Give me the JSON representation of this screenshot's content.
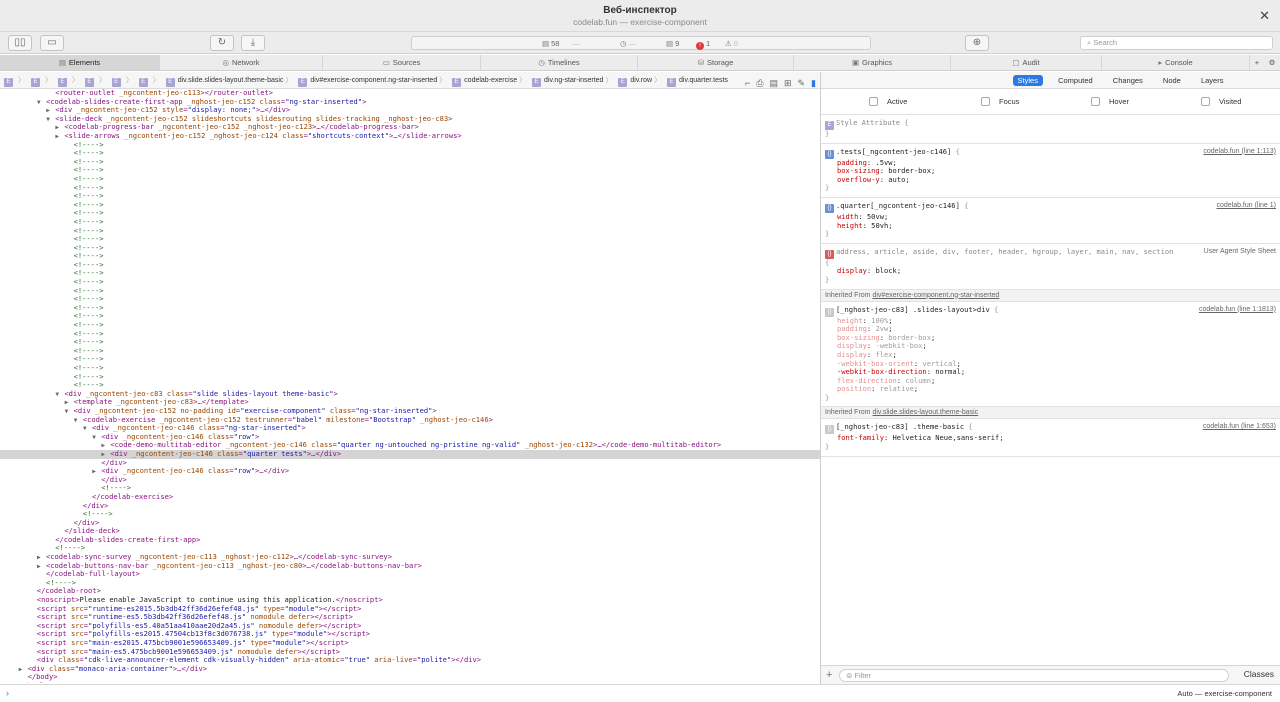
{
  "window": {
    "title": "Веб-инспектор",
    "subtitle": "codelab.fun — exercise-component",
    "close": "✕"
  },
  "toolbar": {
    "activity": {
      "resources": "58",
      "resources_size": "—",
      "time": "—",
      "logs": "9",
      "errors": "1",
      "warnings": "0"
    },
    "search_placeholder": "Search"
  },
  "tabs": [
    {
      "label": "Elements",
      "icon": "▤"
    },
    {
      "label": "Network",
      "icon": "◎"
    },
    {
      "label": "Sources",
      "icon": "▭"
    },
    {
      "label": "Timelines",
      "icon": "◷"
    },
    {
      "label": "Storage",
      "icon": "⛁"
    },
    {
      "label": "Graphics",
      "icon": "▣"
    },
    {
      "label": "Audit",
      "icon": "▢"
    },
    {
      "label": "Console",
      "icon": "▸"
    }
  ],
  "breadcrumb": {
    "e": "E",
    "items": [
      "div.slide.slides-layout.theme-basic",
      "div#exercise-component.ng-star-inserted",
      "codelab-exercise",
      "div.ng-star-inserted",
      "div.row",
      "div.quarter.tests"
    ]
  },
  "dom_lines": [
    {
      "i": 6,
      "t": "",
      "h": "<span class=\"tg\">&lt;router-outlet</span> <span class=\"an\">_ngcontent-jeo-c113</span><span class=\"tg\">&gt;&lt;/router-outlet&gt;</span>"
    },
    {
      "i": 5,
      "t": "▼",
      "h": "<span class=\"tg\">&lt;codelab-slides-create-first-app</span> <span class=\"an\">_nghost-jeo-c152 class</span>=<span class=\"av\">\"ng-star-inserted\"</span><span class=\"tg\">&gt;</span>"
    },
    {
      "i": 6,
      "t": "▶",
      "h": "<span class=\"tg\">&lt;div</span> <span class=\"an\">_ngcontent-jeo-c152 style</span>=<span class=\"av\">\"display: none;\"</span><span class=\"tg\">&gt;</span>…<span class=\"tg\">&lt;/div&gt;</span>"
    },
    {
      "i": 6,
      "t": "▼",
      "h": "<span class=\"tg\">&lt;slide-deck</span> <span class=\"an\">_ngcontent-jeo-c152 slideshortcuts slidesrouting slides-tracking _nghost-jeo-c83</span><span class=\"tg\">&gt;</span>"
    },
    {
      "i": 7,
      "t": "▶",
      "h": "<span class=\"tg\">&lt;codelab-progress-bar</span> <span class=\"an\">_ngcontent-jeo-c152 _nghost-jeo-c123</span><span class=\"tg\">&gt;</span>…<span class=\"tg\">&lt;/codelab-progress-bar&gt;</span>"
    },
    {
      "i": 7,
      "t": "▶",
      "h": "<span class=\"tg\">&lt;slide-arrows</span> <span class=\"an\">_ngcontent-jeo-c152 _nghost-jeo-c124 class</span>=<span class=\"av\">\"shortcuts-context\"</span><span class=\"tg\">&gt;</span>…<span class=\"tg\">&lt;/slide-arrows&gt;</span>"
    },
    {
      "i": 8,
      "t": "",
      "h": "<span class=\"cm\">&lt;!----&gt;</span>"
    },
    {
      "i": 8,
      "t": "",
      "h": "<span class=\"cm\">&lt;!----&gt;</span>"
    },
    {
      "i": 8,
      "t": "",
      "h": "<span class=\"cm\">&lt;!----&gt;</span>"
    },
    {
      "i": 8,
      "t": "",
      "h": "<span class=\"cm\">&lt;!----&gt;</span>"
    },
    {
      "i": 8,
      "t": "",
      "h": "<span class=\"cm\">&lt;!----&gt;</span>"
    },
    {
      "i": 8,
      "t": "",
      "h": "<span class=\"cm\">&lt;!----&gt;</span>"
    },
    {
      "i": 8,
      "t": "",
      "h": "<span class=\"cm\">&lt;!----&gt;</span>"
    },
    {
      "i": 8,
      "t": "",
      "h": "<span class=\"cm\">&lt;!----&gt;</span>"
    },
    {
      "i": 8,
      "t": "",
      "h": "<span class=\"cm\">&lt;!----&gt;</span>"
    },
    {
      "i": 8,
      "t": "",
      "h": "<span class=\"cm\">&lt;!----&gt;</span>"
    },
    {
      "i": 8,
      "t": "",
      "h": "<span class=\"cm\">&lt;!----&gt;</span>"
    },
    {
      "i": 8,
      "t": "",
      "h": "<span class=\"cm\">&lt;!----&gt;</span>"
    },
    {
      "i": 8,
      "t": "",
      "h": "<span class=\"cm\">&lt;!----&gt;</span>"
    },
    {
      "i": 8,
      "t": "",
      "h": "<span class=\"cm\">&lt;!----&gt;</span>"
    },
    {
      "i": 8,
      "t": "",
      "h": "<span class=\"cm\">&lt;!----&gt;</span>"
    },
    {
      "i": 8,
      "t": "",
      "h": "<span class=\"cm\">&lt;!----&gt;</span>"
    },
    {
      "i": 8,
      "t": "",
      "h": "<span class=\"cm\">&lt;!----&gt;</span>"
    },
    {
      "i": 8,
      "t": "",
      "h": "<span class=\"cm\">&lt;!----&gt;</span>"
    },
    {
      "i": 8,
      "t": "",
      "h": "<span class=\"cm\">&lt;!----&gt;</span>"
    },
    {
      "i": 8,
      "t": "",
      "h": "<span class=\"cm\">&lt;!----&gt;</span>"
    },
    {
      "i": 8,
      "t": "",
      "h": "<span class=\"cm\">&lt;!----&gt;</span>"
    },
    {
      "i": 8,
      "t": "",
      "h": "<span class=\"cm\">&lt;!----&gt;</span>"
    },
    {
      "i": 8,
      "t": "",
      "h": "<span class=\"cm\">&lt;!----&gt;</span>"
    },
    {
      "i": 8,
      "t": "",
      "h": "<span class=\"cm\">&lt;!----&gt;</span>"
    },
    {
      "i": 8,
      "t": "",
      "h": "<span class=\"cm\">&lt;!----&gt;</span>"
    },
    {
      "i": 8,
      "t": "",
      "h": "<span class=\"cm\">&lt;!----&gt;</span>"
    },
    {
      "i": 8,
      "t": "",
      "h": "<span class=\"cm\">&lt;!----&gt;</span>"
    },
    {
      "i": 8,
      "t": "",
      "h": "<span class=\"cm\">&lt;!----&gt;</span>"
    },
    {
      "i": 8,
      "t": "",
      "h": "<span class=\"cm\">&lt;!----&gt;</span>"
    },
    {
      "i": 7,
      "t": "▼",
      "h": "<span class=\"tg\">&lt;div</span> <span class=\"an\">_ngcontent-jeo-c83 class</span>=<span class=\"av\">\"slide slides-layout theme-basic\"</span><span class=\"tg\">&gt;</span>"
    },
    {
      "i": 8,
      "t": "▶",
      "h": "<span class=\"tg\">&lt;template</span> <span class=\"an\">_ngcontent-jeo-c83</span><span class=\"tg\">&gt;</span>…<span class=\"tg\">&lt;/template&gt;</span>"
    },
    {
      "i": 8,
      "t": "▼",
      "h": "<span class=\"tg\">&lt;div</span> <span class=\"an\">_ngcontent-jeo-c152 no-padding id</span>=<span class=\"av\">\"exercise-component\"</span> <span class=\"an\">class</span>=<span class=\"av\">\"ng-star-inserted\"</span><span class=\"tg\">&gt;</span>"
    },
    {
      "i": 9,
      "t": "▼",
      "h": "<span class=\"tg\">&lt;codelab-exercise</span> <span class=\"an\">_ngcontent-jeo-c152 testrunner</span>=<span class=\"av\">\"babel\"</span> <span class=\"an\">milestone</span>=<span class=\"av\">\"Bootstrap\"</span> <span class=\"an\">_nghost-jeo-c146</span><span class=\"tg\">&gt;</span>"
    },
    {
      "i": 10,
      "t": "▼",
      "h": "<span class=\"tg\">&lt;div</span> <span class=\"an\">_ngcontent-jeo-c146 class</span>=<span class=\"av\">\"ng-star-inserted\"</span><span class=\"tg\">&gt;</span>"
    },
    {
      "i": 11,
      "t": "▼",
      "h": "<span class=\"tg\">&lt;div</span> <span class=\"an\">_ngcontent-jeo-c146 class</span>=<span class=\"av\">\"row\"</span><span class=\"tg\">&gt;</span>"
    },
    {
      "i": 12,
      "t": "▶",
      "h": "<span class=\"tg\">&lt;code-demo-multitab-editor</span> <span class=\"an\">_ngcontent-jeo-c146 class</span>=<span class=\"av\">\"quarter ng-untouched ng-pristine ng-valid\"</span> <span class=\"an\">_nghost-jeo-c132</span><span class=\"tg\">&gt;</span>…<span class=\"tg\">&lt;/code-demo-multitab-editor&gt;</span>"
    },
    {
      "i": 12,
      "t": "▶",
      "sel": true,
      "h": "<span class=\"tg\">&lt;div</span> <span class=\"an\">_ngcontent-jeo-c146 class</span>=<span class=\"av\">\"quarter tests\"</span><span class=\"tg\">&gt;</span>…<span class=\"tg\">&lt;/div&gt;</span>"
    },
    {
      "i": 11,
      "t": "",
      "h": "<span class=\"tg\">&lt;/div&gt;</span>"
    },
    {
      "i": 11,
      "t": "▶",
      "h": "<span class=\"tg\">&lt;div</span> <span class=\"an\">_ngcontent-jeo-c146 class</span>=<span class=\"av\">\"row\"</span><span class=\"tg\">&gt;</span>…<span class=\"tg\">&lt;/div&gt;</span>"
    },
    {
      "i": 11,
      "t": "",
      "h": "<span class=\"tg\">&lt;/div&gt;</span>"
    },
    {
      "i": 11,
      "t": "",
      "h": "<span class=\"cm\">&lt;!----&gt;</span>"
    },
    {
      "i": 10,
      "t": "",
      "h": "<span class=\"tg\">&lt;/codelab-exercise&gt;</span>"
    },
    {
      "i": 9,
      "t": "",
      "h": "<span class=\"tg\">&lt;/div&gt;</span>"
    },
    {
      "i": 9,
      "t": "",
      "h": "<span class=\"cm\">&lt;!----&gt;</span>"
    },
    {
      "i": 8,
      "t": "",
      "h": "<span class=\"tg\">&lt;/div&gt;</span>"
    },
    {
      "i": 7,
      "t": "",
      "h": "<span class=\"tg\">&lt;/slide-deck&gt;</span>"
    },
    {
      "i": 6,
      "t": "",
      "h": "<span class=\"tg\">&lt;/codelab-slides-create-first-app&gt;</span>"
    },
    {
      "i": 6,
      "t": "",
      "h": "<span class=\"cm\">&lt;!----&gt;</span>"
    },
    {
      "i": 5,
      "t": "▶",
      "h": "<span class=\"tg\">&lt;codelab-sync-survey</span> <span class=\"an\">_ngcontent-jeo-c113 _nghost-jeo-c112</span><span class=\"tg\">&gt;</span>…<span class=\"tg\">&lt;/codelab-sync-survey&gt;</span>"
    },
    {
      "i": 5,
      "t": "▶",
      "h": "<span class=\"tg\">&lt;codelab-buttons-nav-bar</span> <span class=\"an\">_ngcontent-jeo-c113 _nghost-jeo-c80</span><span class=\"tg\">&gt;</span>…<span class=\"tg\">&lt;/codelab-buttons-nav-bar&gt;</span>"
    },
    {
      "i": 5,
      "t": "",
      "h": "<span class=\"tg\">&lt;/codelab-full-layout&gt;</span>"
    },
    {
      "i": 5,
      "t": "",
      "h": "<span class=\"cm\">&lt;!----&gt;</span>"
    },
    {
      "i": 4,
      "t": "",
      "h": "<span class=\"tg\">&lt;/codelab-root&gt;</span>"
    },
    {
      "i": 4,
      "t": "",
      "h": "<span class=\"tg\">&lt;noscript&gt;</span><span class=\"tx\">Please enable JavaScript to continue using this application.</span><span class=\"tg\">&lt;/noscript&gt;</span>"
    },
    {
      "i": 4,
      "t": "",
      "h": "<span class=\"tg\">&lt;script</span> <span class=\"an\">src</span>=<span class=\"av\">\"runtime-es2015.5b3db42ff36d26efef48.js\"</span> <span class=\"an\">type</span>=<span class=\"av\">\"module\"</span><span class=\"tg\">&gt;&lt;/script&gt;</span>"
    },
    {
      "i": 4,
      "t": "",
      "h": "<span class=\"tg\">&lt;script</span> <span class=\"an\">src</span>=<span class=\"av\">\"runtime-es5.5b3db42ff36d26efef48.js\"</span> <span class=\"an\">nomodule defer</span><span class=\"tg\">&gt;&lt;/script&gt;</span>"
    },
    {
      "i": 4,
      "t": "",
      "h": "<span class=\"tg\">&lt;script</span> <span class=\"an\">src</span>=<span class=\"av\">\"polyfills-es5.40a51aa410aae20d2a45.js\"</span> <span class=\"an\">nomodule defer</span><span class=\"tg\">&gt;&lt;/script&gt;</span>"
    },
    {
      "i": 4,
      "t": "",
      "h": "<span class=\"tg\">&lt;script</span> <span class=\"an\">src</span>=<span class=\"av\">\"polyfills-es2015.47504cb13f8c3d076738.js\"</span> <span class=\"an\">type</span>=<span class=\"av\">\"module\"</span><span class=\"tg\">&gt;&lt;/script&gt;</span>"
    },
    {
      "i": 4,
      "t": "",
      "h": "<span class=\"tg\">&lt;script</span> <span class=\"an\">src</span>=<span class=\"av\">\"main-es2015.475bcb9001e596653409.js\"</span> <span class=\"an\">type</span>=<span class=\"av\">\"module\"</span><span class=\"tg\">&gt;&lt;/script&gt;</span>"
    },
    {
      "i": 4,
      "t": "",
      "h": "<span class=\"tg\">&lt;script</span> <span class=\"an\">src</span>=<span class=\"av\">\"main-es5.475bcb9001e596653409.js\"</span> <span class=\"an\">nomodule defer</span><span class=\"tg\">&gt;&lt;/script&gt;</span>"
    },
    {
      "i": 4,
      "t": "",
      "h": "<span class=\"tg\">&lt;div</span> <span class=\"an\">class</span>=<span class=\"av\">\"cdk-live-announcer-element cdk-visually-hidden\"</span> <span class=\"an\">aria-atomic</span>=<span class=\"av\">\"true\"</span> <span class=\"an\">aria-live</span>=<span class=\"av\">\"polite\"</span><span class=\"tg\">&gt;&lt;/div&gt;</span>"
    },
    {
      "i": 3,
      "t": "▶",
      "h": "<span class=\"tg\">&lt;div</span> <span class=\"an\">class</span>=<span class=\"av\">\"monaco-aria-container\"</span><span class=\"tg\">&gt;</span>…<span class=\"tg\">&lt;/div&gt;</span>"
    },
    {
      "i": 3,
      "t": "",
      "h": "<span class=\"tg\">&lt;/body&gt;</span>"
    },
    {
      "i": 2,
      "t": "",
      "h": "<span class=\"tg\">&lt;/html&gt;</span>"
    }
  ],
  "sidebar": {
    "tabs": [
      "Styles",
      "Computed",
      "Changes",
      "Node",
      "Layers"
    ],
    "pseudo": [
      "Active",
      "Focus",
      "Hover",
      "Visited"
    ],
    "style_attribute": "Style Attribute",
    "rules": [
      {
        "badge": "c",
        "selector": ".tests[_ngcontent-jeo-c146]",
        "src": "codelab.fun (line 1:113)",
        "decls": [
          [
            "padding",
            ".5vw"
          ],
          [
            "box-sizing",
            "border-box"
          ],
          [
            "overflow-y",
            "auto"
          ]
        ]
      },
      {
        "badge": "c",
        "selector": ".quarter[_ngcontent-jeo-c146]",
        "src": "codelab.fun (line 1)",
        "decls": [
          [
            "width",
            "50vw"
          ],
          [
            "height",
            "50vh"
          ]
        ]
      },
      {
        "badge": "ua",
        "selector": "address, article, aside, div, footer, header, hgroup, layer, main, nav, section",
        "src": "User Agent Style Sheet",
        "decls": [
          [
            "display",
            "block"
          ]
        ]
      }
    ],
    "inherited": [
      {
        "from_label": "Inherited From",
        "from": "div#exercise-component.ng-star-inserted",
        "selector": "[_nghost-jeo-c83] .slides-layout>div",
        "src": "codelab.fun (line 1:1813)",
        "decls": [
          [
            "height",
            "100%",
            true
          ],
          [
            "padding",
            "2vw",
            true
          ],
          [
            "box-sizing",
            "border-box",
            true
          ],
          [
            "display",
            "-webkit-box",
            true
          ],
          [
            "display",
            "flex",
            true
          ],
          [
            "-webkit-box-orient",
            "vertical",
            true
          ],
          [
            "-webkit-box-direction",
            "normal",
            false
          ],
          [
            "flex-direction",
            "column",
            true
          ],
          [
            "position",
            "relative",
            true
          ]
        ]
      },
      {
        "from_label": "Inherited From",
        "from": "div.slide.slides-layout.theme-basic",
        "selector": "[_nghost-jeo-c83] .theme-basic",
        "src": "codelab.fun (line 1:653)",
        "decls": [
          [
            "font-family",
            "Helvetica Neue,sans-serif",
            false
          ]
        ]
      }
    ],
    "filter_placeholder": "Filter",
    "classes": "Classes"
  },
  "console": {
    "context": "Auto — exercise-component"
  }
}
